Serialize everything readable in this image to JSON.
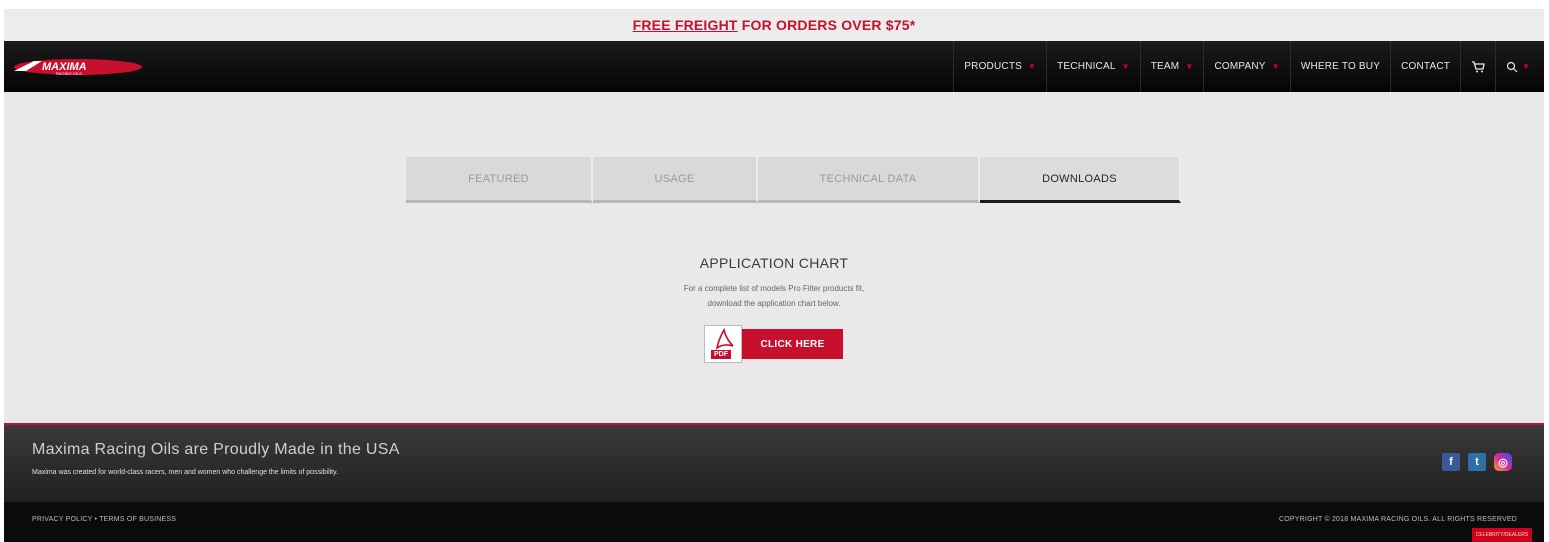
{
  "promo": {
    "highlight": "FREE FREIGHT",
    "rest": " FOR ORDERS OVER $75*"
  },
  "brand": {
    "logo_text": "MAXIMA",
    "logo_subtext": "RACING OILS"
  },
  "nav": {
    "items": [
      {
        "label": "PRODUCTS",
        "has_dropdown": true
      },
      {
        "label": "TECHNICAL",
        "has_dropdown": true
      },
      {
        "label": "TEAM",
        "has_dropdown": true
      },
      {
        "label": "COMPANY",
        "has_dropdown": true
      },
      {
        "label": "WHERE TO BUY",
        "has_dropdown": false
      },
      {
        "label": "CONTACT",
        "has_dropdown": false
      }
    ],
    "cart_icon": "cart-icon",
    "search_icon": "search-icon"
  },
  "tabs": [
    {
      "label": "FEATURED",
      "active": false
    },
    {
      "label": "USAGE",
      "active": false
    },
    {
      "label": "TECHNICAL DATA",
      "active": false
    },
    {
      "label": "DOWNLOADS",
      "active": true
    }
  ],
  "application": {
    "title": "APPLICATION CHART",
    "desc_line1": "For a complete list of models Pro Filter products fit,",
    "desc_line2": "download the application chart below.",
    "pdf_label": "PDF",
    "button_label": "CLICK HERE"
  },
  "footer": {
    "title": "Maxima Racing Oils are Proudly Made in the USA",
    "subtitle": "Maxima was created for world-class racers, men and women who challenge the limits of possibility.",
    "social": [
      "facebook-icon",
      "twitter-icon",
      "instagram-icon"
    ]
  },
  "bottom": {
    "links": "PRIVACY POLICY • TERMS OF BUSINESS",
    "copyright": "COPYRIGHT © 2018 MAXIMA RACING OILS. ALL RIGHTS RESERVED",
    "tag": "CELEBRITY/DEALERS"
  },
  "colors": {
    "accent": "#c8102e",
    "nav_bg": "#0b0b0b",
    "page_bg": "#e9e9e9"
  }
}
